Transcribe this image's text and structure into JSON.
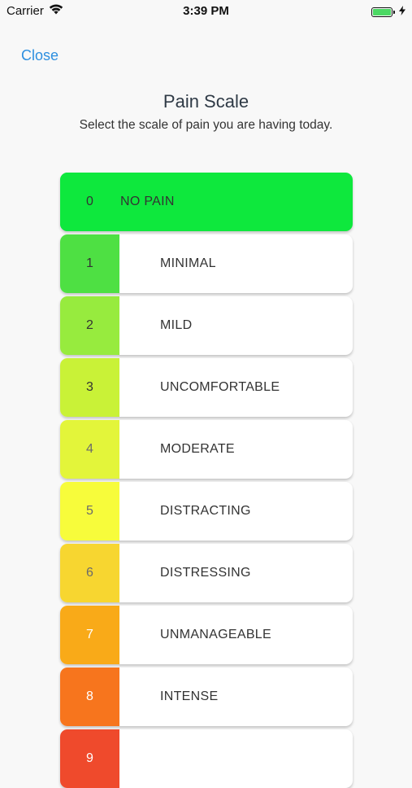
{
  "status_bar": {
    "carrier": "Carrier",
    "time": "3:39 PM",
    "wifi_icon": "wifi-icon",
    "battery_icon": "battery-icon",
    "charging_icon": "bolt-icon"
  },
  "nav": {
    "close_label": "Close"
  },
  "header": {
    "title": "Pain Scale",
    "subtitle": "Select the scale of pain you are having today."
  },
  "scale": {
    "selected_value": "0",
    "items": [
      {
        "value": "0",
        "label": "NO PAIN",
        "color": "#0ee83d",
        "text_color": "#333333"
      },
      {
        "value": "1",
        "label": "MINIMAL",
        "color": "#4ee043",
        "text_color": "#333333"
      },
      {
        "value": "2",
        "label": "MILD",
        "color": "#97eb3e",
        "text_color": "#333333"
      },
      {
        "value": "3",
        "label": "UNCOMFORTABLE",
        "color": "#c9f237",
        "text_color": "#333333"
      },
      {
        "value": "4",
        "label": "MODERATE",
        "color": "#e3f53a",
        "text_color": "#6b6b6b"
      },
      {
        "value": "5",
        "label": "DISTRACTING",
        "color": "#f7fc3b",
        "text_color": "#6b6b6b"
      },
      {
        "value": "6",
        "label": "DISTRESSING",
        "color": "#f7d630",
        "text_color": "#6b6b6b"
      },
      {
        "value": "7",
        "label": "UNMANAGEABLE",
        "color": "#f9aa18",
        "text_color": "#ffffff"
      },
      {
        "value": "8",
        "label": "INTENSE",
        "color": "#f7751d",
        "text_color": "#ffffff"
      },
      {
        "value": "9",
        "label": "",
        "color": "#ef4a2c",
        "text_color": "#ffffff"
      }
    ]
  }
}
